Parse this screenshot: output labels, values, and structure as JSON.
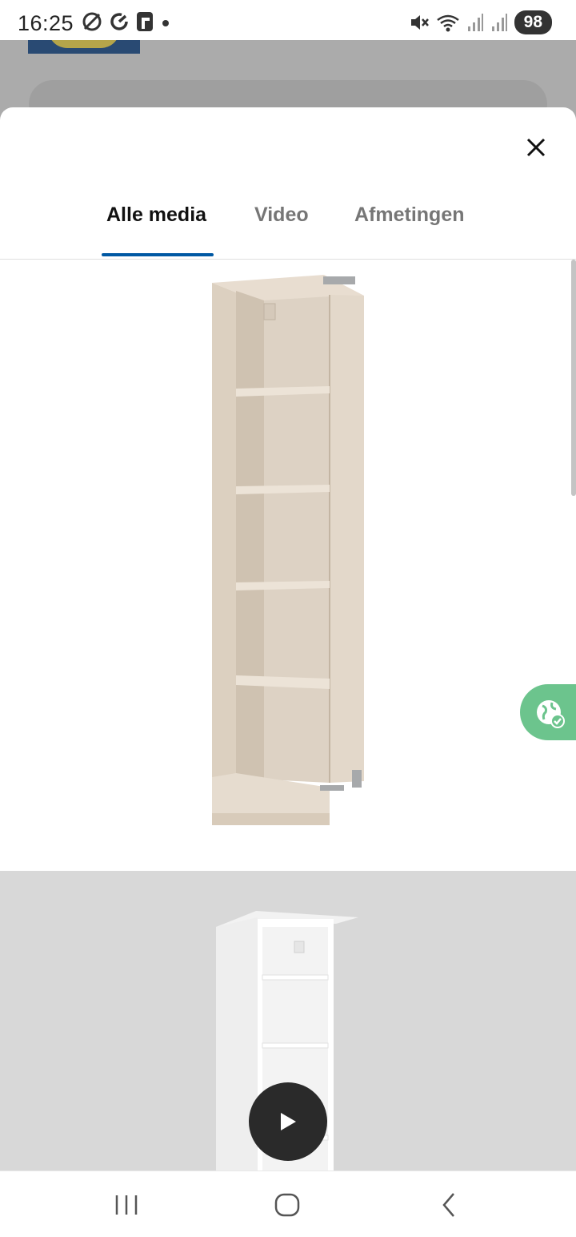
{
  "status_bar": {
    "time": "16:25",
    "battery": "98",
    "left_icons": [
      "data-saver-icon",
      "sync-icon",
      "app-notification-icon",
      "dot-icon"
    ],
    "right_icons": [
      "mute-icon",
      "wifi-icon",
      "signal-icon",
      "signal-icon"
    ]
  },
  "modal": {
    "close_icon": "close-icon",
    "tabs": [
      {
        "label": "Alle media",
        "active": true
      },
      {
        "label": "Video",
        "active": false
      },
      {
        "label": "Afmetingen",
        "active": false
      }
    ],
    "accent_color": "#0058a3"
  },
  "media": [
    {
      "kind": "image",
      "subject": "beige wardrobe frame with shelves"
    },
    {
      "kind": "video",
      "subject": "white wardrobe frame",
      "play_icon": "play-icon"
    }
  ],
  "translate_button": {
    "icon": "translate-globe-icon",
    "color": "#6cc48d"
  },
  "navigation_bar": {
    "buttons": [
      "recent-apps-icon",
      "home-icon",
      "back-icon"
    ]
  }
}
